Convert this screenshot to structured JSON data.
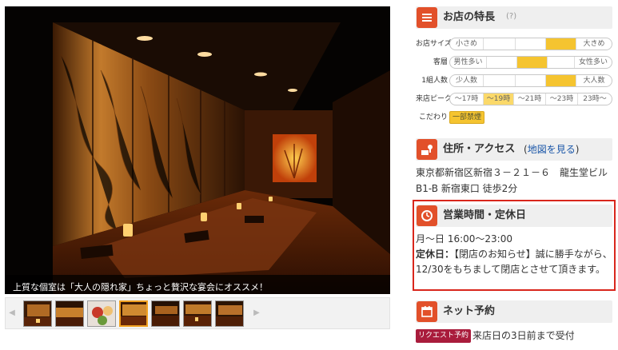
{
  "photo": {
    "caption": "上質な個室は「大人の隠れ家」ちょっと贅沢な宴会にオススメ！"
  },
  "thumbnails": {
    "prev_icon": "triangle-left-icon",
    "next_icon": "triangle-right-icon",
    "count": 7,
    "active_index": 3
  },
  "features": {
    "title": "お店の特長",
    "help": "(?)",
    "icon": "list-icon",
    "rows": [
      {
        "label": "お店サイズ",
        "left": "小さめ",
        "right": "大きめ",
        "level": 4,
        "of": 5
      },
      {
        "label": "客層",
        "left": "男性多い",
        "right": "女性多い",
        "level": 2,
        "of": 4
      },
      {
        "label": "1組人数",
        "left": "少人数",
        "right": "大人数",
        "level": 4,
        "of": 5
      }
    ],
    "peak": {
      "label": "来店ピーク",
      "slots": [
        "〜17時",
        "〜19時",
        "〜21時",
        "〜23時",
        "23時〜"
      ],
      "active_index": 1
    },
    "kodawari": {
      "label": "こだわり",
      "tag": "一部禁煙"
    }
  },
  "access": {
    "title": "住所・アクセス",
    "map_link": "地図を見る",
    "icon": "map-pin-icon",
    "line1": "東京都新宿区新宿３－２１－６　龍生堂ビル",
    "line2": "B1-B 新宿東口 徒歩2分"
  },
  "hours": {
    "title": "営業時間・定休日",
    "icon": "clock-icon",
    "time": "月～日 16:00～23:00",
    "closed_label": "定休日：",
    "closed_text": "【閉店のお知らせ】誠に勝手ながら、12/30をもちまして閉店とさせて頂きます。"
  },
  "reservation": {
    "title": "ネット予約",
    "icon": "calendar-icon",
    "badge": "リクエスト予約",
    "text": "来店日の3日前まで受付"
  },
  "colors": {
    "accent": "#e2502a",
    "highlight_border": "#d9261c",
    "meter_on": "#f5c430",
    "badge": "#a91c3c",
    "link": "#1a56a8"
  }
}
